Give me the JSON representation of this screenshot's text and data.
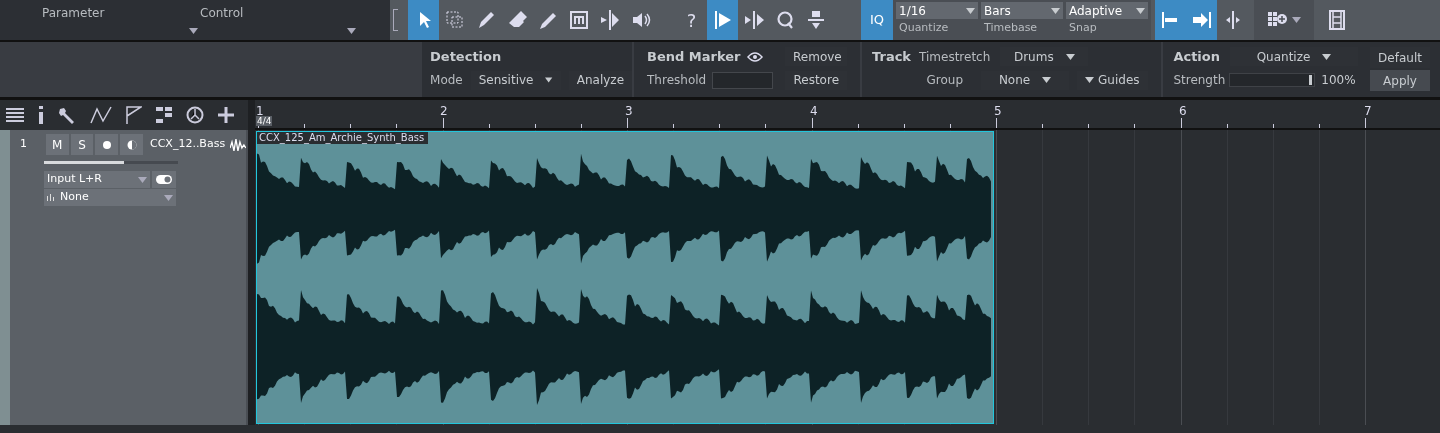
{
  "header_panel": {
    "columns": [
      "Parameter",
      "Control"
    ]
  },
  "edit_tools": [
    {
      "selected": true
    },
    {
      "selected": false
    },
    {
      "selected": false
    },
    {
      "selected": false
    },
    {
      "selected": false
    },
    {
      "selected": false
    },
    {
      "selected": false
    },
    {
      "selected": false
    }
  ],
  "help": "?",
  "bend_tools": [
    {
      "selected": true
    },
    {
      "selected": false
    },
    {
      "selected": false
    },
    {
      "selected": false
    }
  ],
  "iq": {
    "label": "IQ",
    "selected": true
  },
  "quantize_selects": [
    {
      "value": "1/16",
      "label": "Quantize"
    },
    {
      "value": "Bars",
      "label": "Timebase"
    },
    {
      "value": "Adaptive",
      "label": "Snap"
    }
  ],
  "snap_tools": [
    {
      "selected": true
    },
    {
      "selected": true
    },
    {
      "selected": false
    }
  ],
  "inspector": {
    "detection": {
      "title": "Detection",
      "mode_label": "Mode",
      "mode_value": "Sensitive",
      "analyze": "Analyze"
    },
    "bend_marker": {
      "title": "Bend Marker",
      "threshold_label": "Threshold",
      "remove": "Remove",
      "restore": "Restore"
    },
    "track": {
      "title": "Track",
      "timestretch_label": "Timestretch",
      "timestretch_value": "Drums",
      "group_label": "Group",
      "group_value": "None",
      "guides": "Guides"
    },
    "action": {
      "title": "Action",
      "action_value": "Quantize",
      "strength_label": "Strength",
      "strength": {
        "level": 0.97,
        "reading": "100%"
      },
      "default": "Default",
      "apply": "Apply"
    }
  },
  "ruler": {
    "time_signature": "4/4",
    "bars": [
      "1",
      "2",
      "3",
      "4",
      "5",
      "6",
      "7"
    ]
  },
  "tracks": [
    {
      "number": "1",
      "mute": "M",
      "solo": "S",
      "name": "CCX_12..Bass",
      "volume": {
        "level": 0.6
      },
      "input": "Input L+R",
      "output": "None",
      "clip": {
        "name": "CCX_125_Am_Archie_Synth_Bass"
      }
    }
  ]
}
